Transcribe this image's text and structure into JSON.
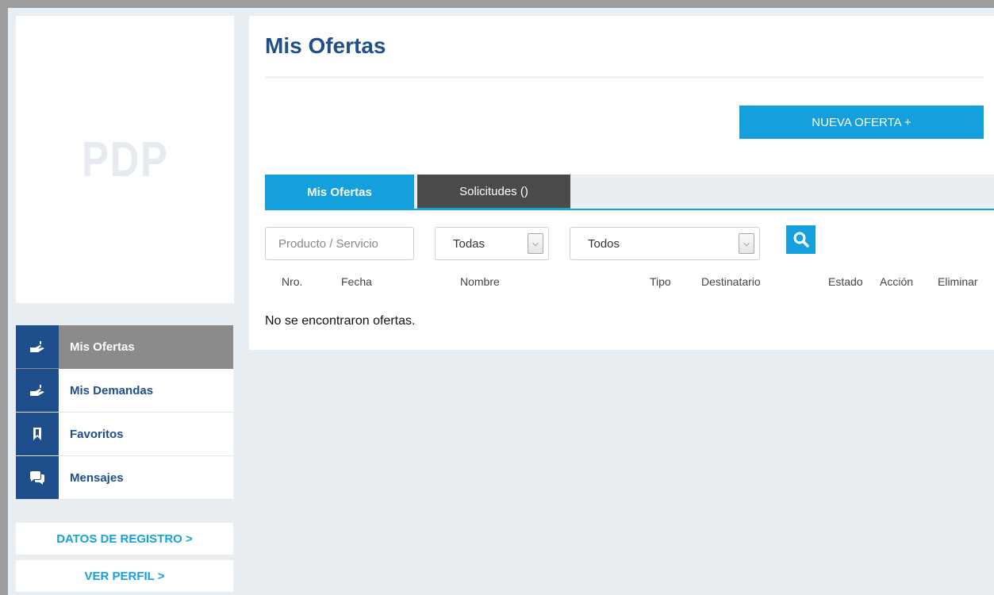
{
  "sidebar": {
    "logo_text": "PDP",
    "nav_items": [
      {
        "label": "Mis Ofertas",
        "icon": "hand-offer-icon",
        "active": true
      },
      {
        "label": "Mis Demandas",
        "icon": "hand-offer-icon",
        "active": false
      },
      {
        "label": "Favoritos",
        "icon": "bookmark-icon",
        "active": false
      },
      {
        "label": "Mensajes",
        "icon": "chat-icon",
        "active": false
      }
    ],
    "links": {
      "registro": "DATOS DE REGISTRO >",
      "perfil": "VER PERFIL >"
    }
  },
  "main": {
    "title": "Mis Ofertas",
    "new_offer_label": "NUEVA OFERTA  +",
    "tabs": [
      {
        "label": "Mis Ofertas",
        "active": true
      },
      {
        "label": "Solicitudes ()",
        "active": false
      }
    ],
    "filters": {
      "search_placeholder": "Producto / Servicio",
      "select1_value": "Todas",
      "select2_value": "Todos"
    },
    "columns": [
      "Nro.",
      "Fecha",
      "Nombre",
      "Tipo",
      "Destinatario",
      "Estado",
      "Acción",
      "Eliminar"
    ],
    "empty_message": "No se encontraron ofertas."
  },
  "colors": {
    "brand_blue": "#1e4e8c",
    "accent_cyan": "#14a0dc",
    "active_gray": "#8b8b8b",
    "tab_dark": "#4a4a4a"
  }
}
